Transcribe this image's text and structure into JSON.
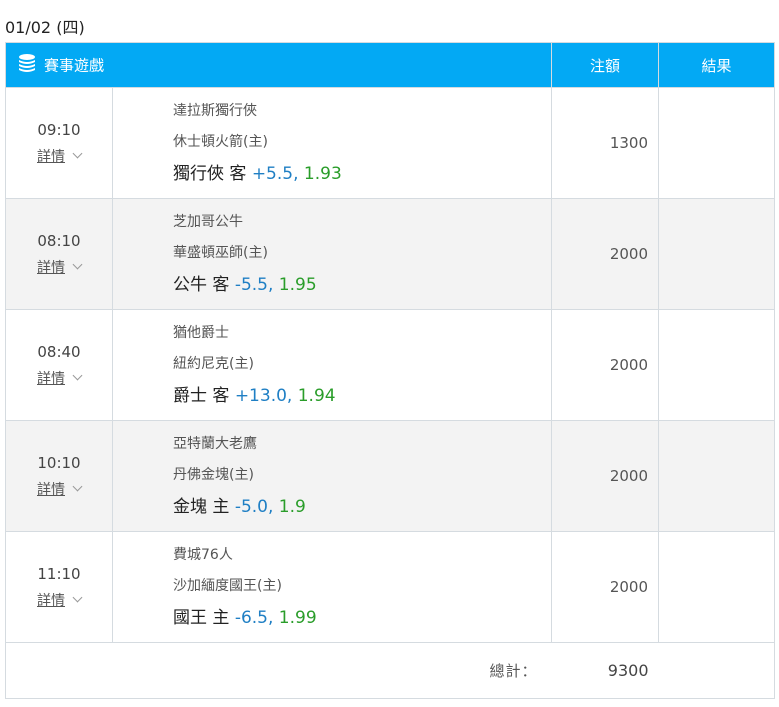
{
  "date": "01/02 (四)",
  "header": {
    "game": "賽事遊戲",
    "amount": "注額",
    "result": "結果"
  },
  "colors": {
    "header_bg": "#03a9f4",
    "handicap": "#1f7fc4",
    "odds": "#2a9d2a"
  },
  "details_label": "詳情",
  "rows": [
    {
      "time": "09:10",
      "away": "達拉斯獨行俠",
      "home": "休士頓火箭(主)",
      "pick": "獨行俠 客",
      "handicap": "+5.5",
      "sep": ",",
      "odds": "1.93",
      "amount": "1300",
      "result": ""
    },
    {
      "time": "08:10",
      "away": "芝加哥公牛",
      "home": "華盛頓巫師(主)",
      "pick": "公牛 客",
      "handicap": "-5.5",
      "sep": ",",
      "odds": "1.95",
      "amount": "2000",
      "result": ""
    },
    {
      "time": "08:40",
      "away": "猶他爵士",
      "home": "紐約尼克(主)",
      "pick": "爵士 客",
      "handicap": "+13.0",
      "sep": ",",
      "odds": "1.94",
      "amount": "2000",
      "result": ""
    },
    {
      "time": "10:10",
      "away": "亞特蘭大老鷹",
      "home": "丹佛金塊(主)",
      "pick": "金塊 主",
      "handicap": "-5.0",
      "sep": ",",
      "odds": "1.9",
      "amount": "2000",
      "result": ""
    },
    {
      "time": "11:10",
      "away": "費城76人",
      "home": "沙加緬度國王(主)",
      "pick": "國王 主",
      "handicap": "-6.5",
      "sep": ",",
      "odds": "1.99",
      "amount": "2000",
      "result": ""
    }
  ],
  "total": {
    "label": "總計：",
    "value": "9300"
  }
}
